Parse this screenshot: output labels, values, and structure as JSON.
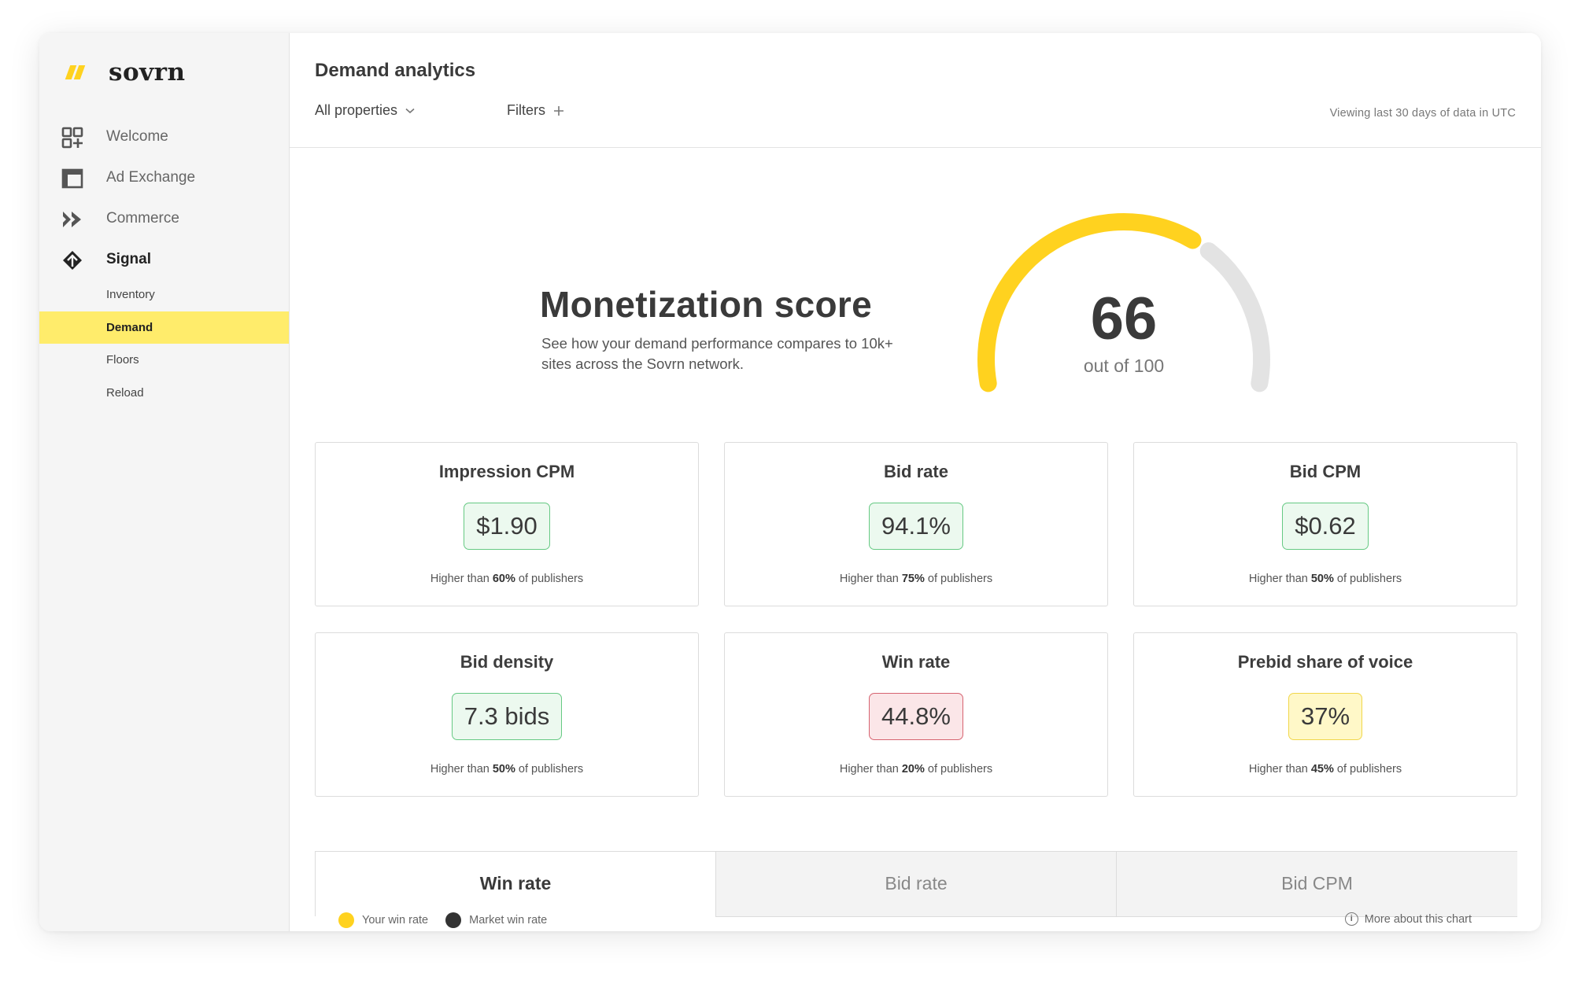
{
  "app": {
    "logo_text": "sovrn"
  },
  "sidebar": {
    "items": [
      {
        "label": "Welcome",
        "icon": "grid-plus-icon"
      },
      {
        "label": "Ad Exchange",
        "icon": "window-icon"
      },
      {
        "label": "Commerce",
        "icon": "double-chevron-icon"
      },
      {
        "label": "Signal",
        "icon": "signal-diamond-icon"
      }
    ],
    "sub_items": [
      {
        "label": "Inventory"
      },
      {
        "label": "Demand",
        "selected": true
      },
      {
        "label": "Floors"
      },
      {
        "label": "Reload"
      }
    ]
  },
  "header": {
    "title": "Demand analytics",
    "properties_label": "All properties",
    "filters_label": "Filters",
    "viewing_text": "Viewing last 30 days of data in UTC"
  },
  "score": {
    "title": "Monetization score",
    "description": "See how your demand performance compares to 10k+ sites across the Sovrn network.",
    "value": 66,
    "max": 100,
    "caption": "out of 100",
    "fill_color": "#ffd21f",
    "track_color": "#e3e3e3"
  },
  "metrics": [
    {
      "title": "Impression CPM",
      "value": "$1.90",
      "status": "good",
      "foot_prefix": "Higher than ",
      "foot_pct": "60%",
      "foot_suffix": " of publishers"
    },
    {
      "title": "Bid rate",
      "value": "94.1%",
      "status": "good",
      "foot_prefix": "Higher than ",
      "foot_pct": "75%",
      "foot_suffix": " of publishers"
    },
    {
      "title": "Bid CPM",
      "value": "$0.62",
      "status": "good",
      "foot_prefix": "Higher than ",
      "foot_pct": "50%",
      "foot_suffix": " of publishers"
    },
    {
      "title": "Bid density",
      "value": "7.3 bids",
      "status": "good",
      "foot_prefix": "Higher than ",
      "foot_pct": "50%",
      "foot_suffix": " of publishers"
    },
    {
      "title": "Win rate",
      "value": "44.8%",
      "status": "bad",
      "foot_prefix": "Higher than ",
      "foot_pct": "20%",
      "foot_suffix": " of publishers"
    },
    {
      "title": "Prebid share of voice",
      "value": "37%",
      "status": "mid",
      "foot_prefix": "Higher than ",
      "foot_pct": "45%",
      "foot_suffix": " of publishers"
    }
  ],
  "tabs": [
    {
      "label": "Win rate",
      "active": true
    },
    {
      "label": "Bid rate"
    },
    {
      "label": "Bid CPM"
    }
  ],
  "legend": {
    "items": [
      {
        "label": "Your win rate",
        "color": "#ffd21f"
      },
      {
        "label": "Market win rate",
        "color": "#333333"
      }
    ],
    "more_info_label": "More about this chart"
  }
}
